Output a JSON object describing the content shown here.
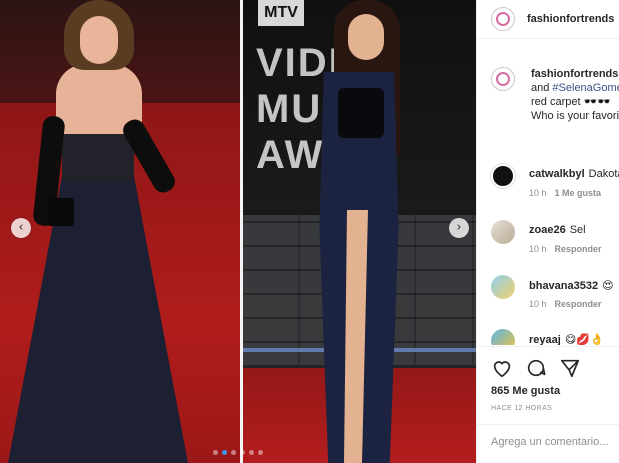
{
  "post": {
    "carousel": {
      "slide_count": 6,
      "active_index": 1,
      "prev_label": "‹",
      "next_label": "›"
    },
    "wall_text": {
      "logo": "MTV",
      "lines": [
        "VIDE",
        "MU",
        "AW"
      ]
    }
  },
  "header": {
    "username": "fashionfortrends"
  },
  "caption": {
    "username": "fashionfortrends",
    "lines": [
      "fashionfortrends 🌸",
      "and #SelenaGomez",
      "red carpet 🕶️🕶️",
      "Who is your favorite"
    ],
    "hashtag": "#SelenaGomez"
  },
  "comments": [
    {
      "username": "catwalkbyl",
      "text": "Dakota",
      "age": "10 h",
      "likes": "1 Me gusta",
      "reply": ""
    },
    {
      "username": "zoae26",
      "text": "Sel",
      "age": "10 h",
      "likes": "",
      "reply": "Responder"
    },
    {
      "username": "bhavana3532",
      "text": "😍",
      "age": "10 h",
      "likes": "",
      "reply": "Responder"
    },
    {
      "username": "reyaaj",
      "text": "😋💋👌",
      "age": "",
      "likes": "",
      "reply": ""
    }
  ],
  "actions": {
    "like_count": "865 Me gusta",
    "timestamp": "HACE 12 HORAS",
    "comment_placeholder": "Agrega un comentario..."
  },
  "colors": {
    "accent": "#3897f0",
    "link": "#385185",
    "muted": "#8e8e8e"
  }
}
